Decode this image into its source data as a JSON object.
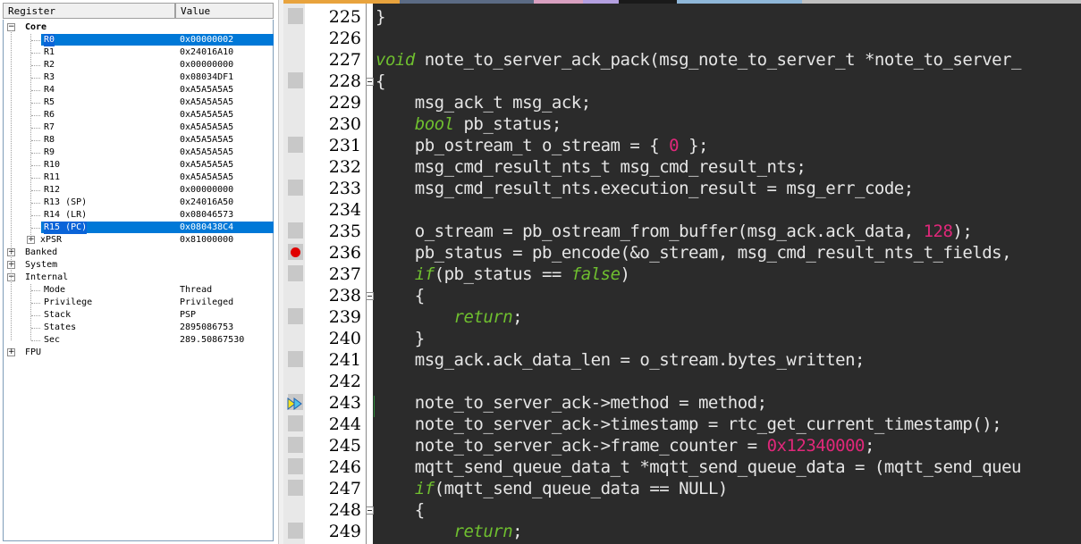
{
  "registers": {
    "header": {
      "col_register": "Register",
      "col_value": "Value"
    },
    "rows": [
      {
        "name": "Core",
        "value": "",
        "level": 0,
        "expander": "−",
        "group": true
      },
      {
        "name": "R0",
        "value": "0x00000002",
        "level": 2,
        "selected": true
      },
      {
        "name": "R1",
        "value": "0x24016A10",
        "level": 2
      },
      {
        "name": "R2",
        "value": "0x00000000",
        "level": 2
      },
      {
        "name": "R3",
        "value": "0x08034DF1",
        "level": 2
      },
      {
        "name": "R4",
        "value": "0xA5A5A5A5",
        "level": 2
      },
      {
        "name": "R5",
        "value": "0xA5A5A5A5",
        "level": 2
      },
      {
        "name": "R6",
        "value": "0xA5A5A5A5",
        "level": 2
      },
      {
        "name": "R7",
        "value": "0xA5A5A5A5",
        "level": 2
      },
      {
        "name": "R8",
        "value": "0xA5A5A5A5",
        "level": 2
      },
      {
        "name": "R9",
        "value": "0xA5A5A5A5",
        "level": 2
      },
      {
        "name": "R10",
        "value": "0xA5A5A5A5",
        "level": 2
      },
      {
        "name": "R11",
        "value": "0xA5A5A5A5",
        "level": 2
      },
      {
        "name": "R12",
        "value": "0x00000000",
        "level": 2
      },
      {
        "name": "R13 (SP)",
        "value": "0x24016A50",
        "level": 2
      },
      {
        "name": "R14 (LR)",
        "value": "0x08046573",
        "level": 2
      },
      {
        "name": "R15 (PC)",
        "value": "0x080438C4",
        "level": 2,
        "selected": true
      },
      {
        "name": "xPSR",
        "value": "0x81000000",
        "level": 1,
        "expander": "+"
      },
      {
        "name": "Banked",
        "value": "",
        "level": 0,
        "expander": "+"
      },
      {
        "name": "System",
        "value": "",
        "level": 0,
        "expander": "+"
      },
      {
        "name": "Internal",
        "value": "",
        "level": 0,
        "expander": "−"
      },
      {
        "name": "Mode",
        "value": "Thread",
        "level": 2
      },
      {
        "name": "Privilege",
        "value": "Privileged",
        "level": 2
      },
      {
        "name": "Stack",
        "value": "PSP",
        "level": 2
      },
      {
        "name": "States",
        "value": "2895086753",
        "level": 2
      },
      {
        "name": "Sec",
        "value": "289.50867530",
        "level": 2
      },
      {
        "name": "FPU",
        "value": "",
        "level": 0,
        "expander": "+"
      }
    ]
  },
  "editor": {
    "tab_colors": [
      "#e8a33d",
      "#5b6b84",
      "#d9a0c0",
      "#b4a0e0",
      "#1a1a1a",
      "#8fb7d9",
      "#c0c0c0"
    ],
    "lines": [
      {
        "no": "225",
        "code": [
          [
            "}",
            "fn"
          ]
        ],
        "mark": true
      },
      {
        "no": "226",
        "code": [
          [
            "",
            "fn"
          ]
        ],
        "mark": false
      },
      {
        "no": "227",
        "code": [
          [
            "void",
            "kw"
          ],
          [
            " note_to_server_ack_pack(msg_note_to_server_t *note_to_server_",
            "fn"
          ]
        ],
        "mark": false
      },
      {
        "no": "228",
        "code": [
          [
            "{",
            "fn"
          ]
        ],
        "mark": true,
        "fold": true
      },
      {
        "no": "229",
        "code": [
          [
            "    msg_ack_t msg_ack;",
            "fn"
          ]
        ],
        "mark": false
      },
      {
        "no": "230",
        "code": [
          [
            "    ",
            "fn"
          ],
          [
            "bool",
            "kw"
          ],
          [
            " pb_status;",
            "fn"
          ]
        ],
        "mark": false
      },
      {
        "no": "231",
        "code": [
          [
            "    pb_ostream_t o_stream = { ",
            "fn"
          ],
          [
            "0",
            "num"
          ],
          [
            " };",
            "fn"
          ]
        ],
        "mark": true
      },
      {
        "no": "232",
        "code": [
          [
            "    msg_cmd_result_nts_t msg_cmd_result_nts;",
            "fn"
          ]
        ],
        "mark": false
      },
      {
        "no": "233",
        "code": [
          [
            "    msg_cmd_result_nts.execution_result = msg_err_code;",
            "fn"
          ]
        ],
        "mark": true
      },
      {
        "no": "234",
        "code": [
          [
            "",
            "fn"
          ]
        ],
        "mark": false
      },
      {
        "no": "235",
        "code": [
          [
            "    o_stream = pb_ostream_from_buffer(msg_ack.ack_data, ",
            "fn"
          ],
          [
            "128",
            "num"
          ],
          [
            ");",
            "fn"
          ]
        ],
        "mark": true
      },
      {
        "no": "236",
        "code": [
          [
            "    pb_status = pb_encode(&o_stream, msg_cmd_result_nts_t_fields, ",
            "fn"
          ]
        ],
        "mark": true,
        "breakpoint": true
      },
      {
        "no": "237",
        "code": [
          [
            "    ",
            "fn"
          ],
          [
            "if",
            "kw"
          ],
          [
            "(pb_status == ",
            "fn"
          ],
          [
            "false",
            "kw"
          ],
          [
            ")",
            "fn"
          ]
        ],
        "mark": true
      },
      {
        "no": "238",
        "code": [
          [
            "    {",
            "fn"
          ]
        ],
        "mark": false,
        "fold": true
      },
      {
        "no": "239",
        "code": [
          [
            "        ",
            "fn"
          ],
          [
            "return",
            "kw"
          ],
          [
            ";",
            "fn"
          ]
        ],
        "mark": true
      },
      {
        "no": "240",
        "code": [
          [
            "    }",
            "fn"
          ]
        ],
        "mark": false
      },
      {
        "no": "241",
        "code": [
          [
            "    msg_ack.ack_data_len = o_stream.bytes_written;",
            "fn"
          ]
        ],
        "mark": true
      },
      {
        "no": "242",
        "code": [
          [
            "",
            "fn"
          ]
        ],
        "mark": false
      },
      {
        "no": "243",
        "code": [
          [
            "    note_to_server_ack->method = method;",
            "fn"
          ]
        ],
        "mark": true,
        "pc": true
      },
      {
        "no": "244",
        "code": [
          [
            "    note_to_server_ack->timestamp = rtc_get_current_timestamp();",
            "fn"
          ]
        ],
        "mark": true
      },
      {
        "no": "245",
        "code": [
          [
            "    note_to_server_ack->frame_counter = ",
            "fn"
          ],
          [
            "0x12340000",
            "num"
          ],
          [
            ";",
            "fn"
          ]
        ],
        "mark": true
      },
      {
        "no": "246",
        "code": [
          [
            "    mqtt_send_queue_data_t *mqtt_send_queue_data = (mqtt_send_queu",
            "fn"
          ]
        ],
        "mark": true
      },
      {
        "no": "247",
        "code": [
          [
            "    ",
            "fn"
          ],
          [
            "if",
            "kw"
          ],
          [
            "(mqtt_send_queue_data == NULL)",
            "fn"
          ]
        ],
        "mark": true
      },
      {
        "no": "248",
        "code": [
          [
            "    {",
            "fn"
          ]
        ],
        "mark": false,
        "fold": true
      },
      {
        "no": "249",
        "code": [
          [
            "        ",
            "fn"
          ],
          [
            "return",
            "kw"
          ],
          [
            ";",
            "fn"
          ]
        ],
        "mark": true
      }
    ]
  }
}
